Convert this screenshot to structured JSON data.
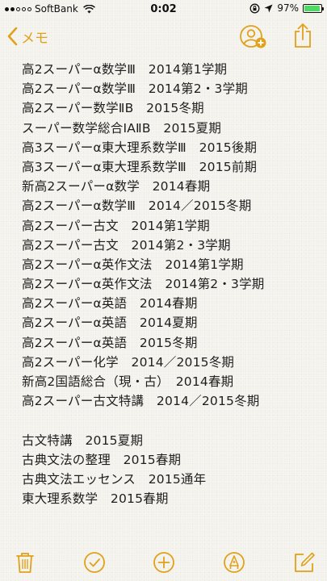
{
  "status_bar": {
    "carrier": "SoftBank",
    "time": "0:02",
    "battery_percent": "97%",
    "battery_level": 0.97,
    "icons": [
      "signal-dots",
      "wifi-icon",
      "orientation-lock-icon",
      "location-arrow-icon",
      "battery-icon"
    ]
  },
  "nav": {
    "back_label": "メモ",
    "collab_icon": "add-person-icon",
    "share_icon": "share-icon"
  },
  "note": {
    "lines": [
      "高2スーパーα数学Ⅲ　2014第1学期",
      "高2スーパーα数学Ⅲ　2014第2・3学期",
      "高2スーパー数学ⅡB　2015冬期",
      "スーパー数学総合ⅠAⅡB　2015夏期",
      "高3スーパーα東大理系数学Ⅲ　2015後期",
      "高3スーパーα東大理系数学Ⅲ　2015前期",
      "新高2スーパーα数学　2014春期",
      "高2スーパーα数学Ⅲ　2014／2015冬期",
      "高2スーパー古文　2014第1学期",
      "高2スーパー古文　2014第2・3学期",
      "高2スーパーα英作文法　2014第1学期",
      "高2スーパーα英作文法　2014第2・3学期",
      "高2スーパーα英語　2014春期",
      "高2スーパーα英語　2014夏期",
      "高2スーパーα英語　2015冬期",
      "高2スーパー化学　2014／2015冬期",
      "新高2国語総合（現・古）　2014春期",
      "高2スーパー古文特講　2014／2015冬期",
      "",
      "古文特講　2015夏期",
      "古典文法の整理　2015春期",
      "古典文法エッセンス　2015通年",
      "東大理系数学　2015春期"
    ]
  },
  "toolbar": {
    "items": [
      "trash-icon",
      "checklist-icon",
      "add-icon",
      "markup-pen-icon",
      "compose-icon"
    ]
  },
  "colors": {
    "accent": "#e0a11b",
    "text": "#1e1e1e",
    "paper": "#f7f5f0",
    "battery": "#4cd964"
  }
}
